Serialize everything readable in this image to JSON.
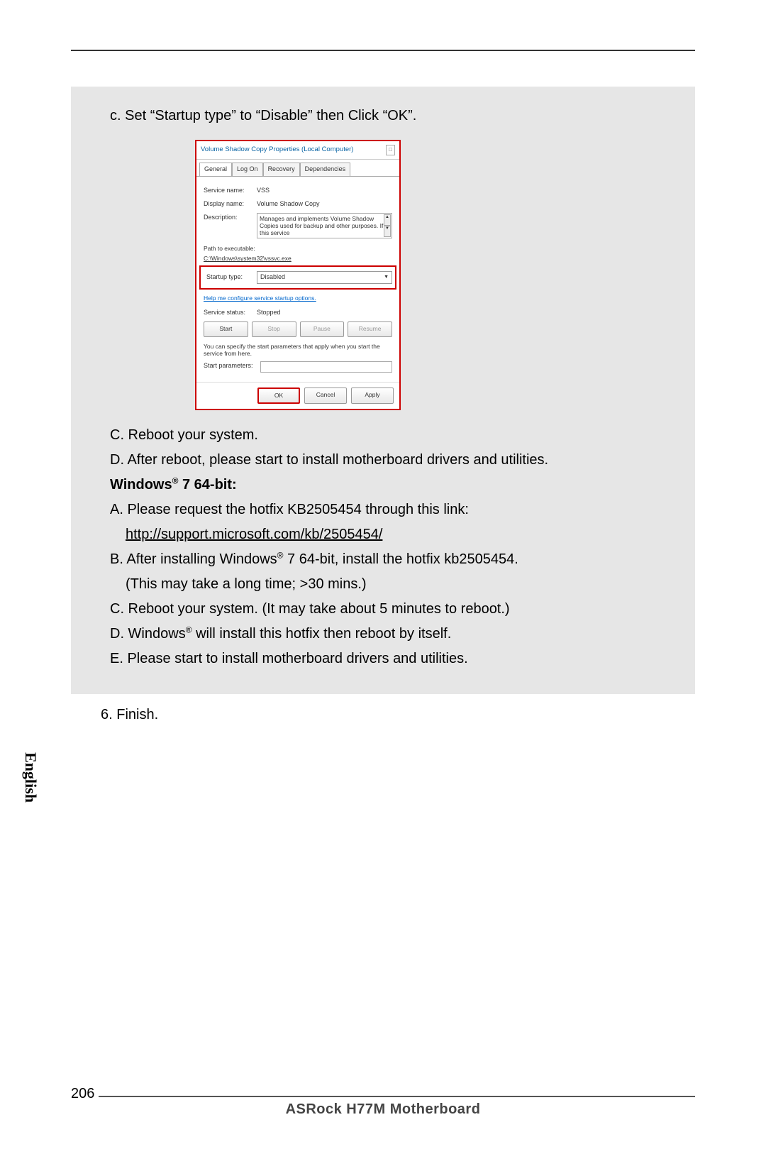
{
  "instruction_c": "c. Set “Startup type” to “Disable” then Click “OK”.",
  "dialog": {
    "title": "Volume Shadow Copy Properties (Local Computer)",
    "close": "□",
    "tabs": [
      "General",
      "Log On",
      "Recovery",
      "Dependencies"
    ],
    "service_name_label": "Service name:",
    "service_name_value": "VSS",
    "display_name_label": "Display name:",
    "display_name_value": "Volume Shadow Copy",
    "description_label": "Description:",
    "description_value": "Manages and implements Volume Shadow Copies used for backup and other purposes. If this service",
    "path_label": "Path to executable:",
    "path_value": "C:\\Windows\\system32\\vssvc.exe",
    "startup_label": "Startup type:",
    "startup_value": "Disabled",
    "help_link": "Help me configure service startup options.",
    "status_label": "Service status:",
    "status_value": "Stopped",
    "btn_start": "Start",
    "btn_stop": "Stop",
    "btn_pause": "Pause",
    "btn_resume": "Resume",
    "hint": "You can specify the start parameters that apply when you start the service from here.",
    "start_params_label": "Start parameters:",
    "btn_ok": "OK",
    "btn_cancel": "Cancel",
    "btn_apply": "Apply"
  },
  "step_C1": "C. Reboot your system.",
  "step_D1": "D. After reboot, please start to install motherboard drivers and utilities.",
  "win7_heading_pre": "Windows",
  "win7_heading_post": " 7 64-bit:",
  "step_A2": "A. Please request the hotfix KB2505454 through this link:",
  "step_A2_link": "http://support.microsoft.com/kb/2505454/",
  "step_B2_pre": "B. After installing Windows",
  "step_B2_post": " 7 64-bit, install the hotfix kb2505454.",
  "step_B2_note": "(This may take a long time; >30 mins.)",
  "step_C2": "C. Reboot your system. (It may take about 5 minutes to reboot.)",
  "step_D2_pre": "D. Windows",
  "step_D2_post": " will install this hotfix then reboot by itself.",
  "step_E2": "E. Please start to install motherboard drivers and utilities.",
  "step6": "6. Finish.",
  "side_label": "English",
  "page_number": "206",
  "footer_title": "ASRock  H77M  Motherboard",
  "reg": "®"
}
